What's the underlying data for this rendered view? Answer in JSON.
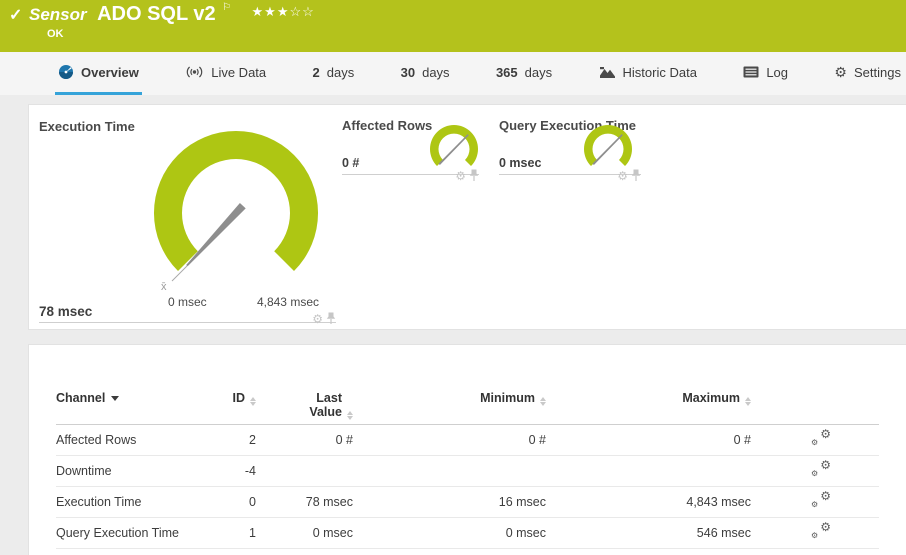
{
  "header": {
    "check_icon": "✓",
    "kind": "Sensor",
    "title": "ADO SQL v2",
    "flag_icon": "⚐",
    "stars_filled": "★★★",
    "stars_empty": "☆☆",
    "status": "OK"
  },
  "tabs": [
    {
      "label": "Overview",
      "active": true
    },
    {
      "label": "Live Data"
    },
    {
      "num": "2",
      "label": "days"
    },
    {
      "num": "30",
      "label": "days"
    },
    {
      "num": "365",
      "label": "days"
    },
    {
      "label": "Historic Data"
    },
    {
      "label": "Log"
    },
    {
      "label": "Settings"
    }
  ],
  "icons": {
    "gear": "⚙"
  },
  "widgets": {
    "execution_time": {
      "title": "Execution Time",
      "value": "78 msec",
      "scale_min": "0 msec",
      "scale_max": "4,843 msec",
      "avg_marker": "x̄"
    },
    "affected_rows": {
      "title": "Affected Rows",
      "value": "0 #"
    },
    "query_execution_time": {
      "title": "Query Execution Time",
      "value": "0 msec"
    }
  },
  "chart_data": [
    {
      "type": "gauge",
      "title": "Execution Time",
      "value": 78,
      "min": 0,
      "max": 4843,
      "unit": "msec",
      "value_label": "78 msec"
    },
    {
      "type": "gauge",
      "title": "Affected Rows",
      "value": 0,
      "unit": "#",
      "value_label": "0 #"
    },
    {
      "type": "gauge",
      "title": "Query Execution Time",
      "value": 0,
      "unit": "msec",
      "value_label": "0 msec"
    }
  ],
  "table": {
    "columns": {
      "channel": "Channel",
      "id": "ID",
      "last_value": "Last Value",
      "minimum": "Minimum",
      "maximum": "Maximum"
    },
    "rows": [
      {
        "channel": "Affected Rows",
        "id": "2",
        "last_value": "0 #",
        "minimum": "0 #",
        "maximum": "0 #"
      },
      {
        "channel": "Downtime",
        "id": "-4",
        "last_value": "",
        "minimum": "",
        "maximum": ""
      },
      {
        "channel": "Execution Time",
        "id": "0",
        "last_value": "78 msec",
        "minimum": "16 msec",
        "maximum": "4,843 msec"
      },
      {
        "channel": "Query Execution Time",
        "id": "1",
        "last_value": "0 msec",
        "minimum": "0 msec",
        "maximum": "546 msec"
      }
    ]
  },
  "colors": {
    "header_green": "#b4c21c",
    "gauge_green": "#aec613",
    "active_tab_blue": "#35a3d9",
    "needle_gray": "#8e8e8e",
    "icon_gray": "#c6c6c6"
  }
}
